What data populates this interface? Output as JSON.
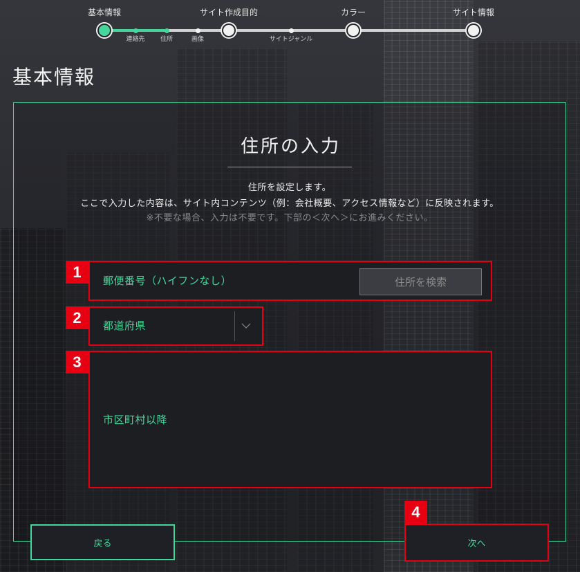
{
  "stepper": {
    "steps": [
      {
        "label": "基本情報",
        "current": true
      },
      {
        "label": "サイト作成目的",
        "current": false
      },
      {
        "label": "カラー",
        "current": false
      },
      {
        "label": "サイト情報",
        "current": false
      }
    ],
    "substeps": [
      {
        "label": "連絡先",
        "completed": true
      },
      {
        "label": "住所",
        "completed": true
      },
      {
        "label": "画像",
        "completed": false
      },
      {
        "label": "サイトジャンル",
        "completed": false
      }
    ]
  },
  "page_title": "基本情報",
  "card": {
    "title": "住所の入力",
    "description": [
      "住所を設定します。",
      "ここで入力した内容は、サイト内コンテンツ（例：会社概要、アクセス情報など）に反映されます。"
    ],
    "note": "※不要な場合、入力は不要です。下部の＜次へ＞にお進みください。"
  },
  "form": {
    "postal_code": {
      "value": "",
      "placeholder": "郵便番号（ハイフンなし）"
    },
    "search_address_button": {
      "label": "住所を検索",
      "disabled": true
    },
    "prefecture": {
      "placeholder": "都道府県",
      "icon": "chevron-down-icon"
    },
    "address": {
      "value": "",
      "placeholder": "市区町村以降"
    }
  },
  "navigation": {
    "back_label": "戻る",
    "next_label": "次へ"
  },
  "annotations": [
    "1",
    "2",
    "3",
    "4"
  ],
  "colors": {
    "accent": "#45d69b",
    "background": "#2b2c31",
    "field_background": "#1d1e22",
    "text": "#f2f2f2",
    "muted_text": "#8a8a8a",
    "annotation": "#e60012"
  }
}
